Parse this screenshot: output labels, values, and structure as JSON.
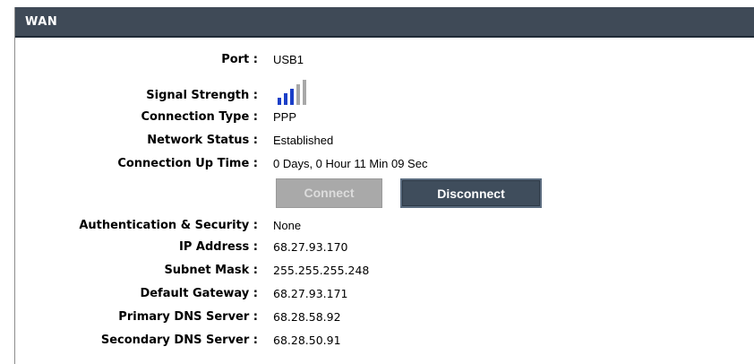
{
  "section": {
    "title": "WAN"
  },
  "fields": {
    "port": {
      "label": "Port :",
      "value": "USB1"
    },
    "signal_strength": {
      "label": "Signal Strength :",
      "bars_active": 3,
      "bars_total": 5,
      "active_color": "#1b3fc8",
      "inactive_color": "#a8a8a8"
    },
    "connection_type": {
      "label": "Connection Type :",
      "value": "PPP"
    },
    "network_status": {
      "label": "Network Status :",
      "value": "Established"
    },
    "connection_up_time": {
      "label": "Connection Up Time :",
      "value": "0 Days, 0 Hour 11 Min 09 Sec"
    },
    "auth_security": {
      "label": "Authentication & Security :",
      "value": "None"
    },
    "ip_address": {
      "label": "IP Address :",
      "value": "68.27.93.170"
    },
    "subnet_mask": {
      "label": "Subnet Mask :",
      "value": "255.255.255.248"
    },
    "default_gateway": {
      "label": "Default Gateway :",
      "value": "68.27.93.171"
    },
    "primary_dns": {
      "label": "Primary DNS Server :",
      "value": "68.28.58.92"
    },
    "secondary_dns": {
      "label": "Secondary DNS Server :",
      "value": "68.28.50.91"
    }
  },
  "buttons": {
    "connect": {
      "label": "Connect",
      "enabled": false
    },
    "disconnect": {
      "label": "Disconnect",
      "enabled": true
    }
  },
  "colors": {
    "header_bg": "#3f4a57",
    "button_active_bg": "#3f4d5c",
    "button_disabled_bg": "#a9a9a9"
  }
}
